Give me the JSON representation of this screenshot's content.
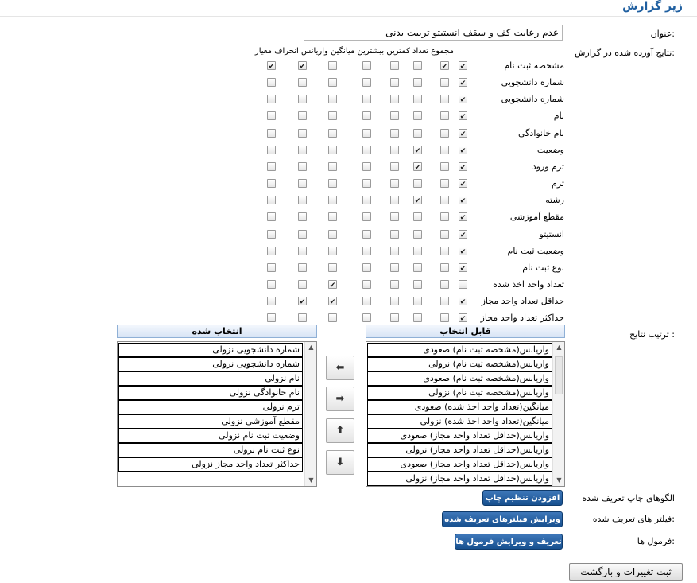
{
  "section_title": "زیر گزارش",
  "title_label": "عنوان:",
  "title_value": "عدم رعایت کف و سقف انستیتو تربیت بدنی",
  "results_label": "نتایج آورده شده در گزارش:",
  "column_headers": "مجموع تعداد کمترین بیشترین میانگین واریانس انحراف معیار",
  "rows": [
    {
      "label": "مشخصه ثبت نام",
      "checks": [
        true,
        true,
        false,
        false,
        false,
        false,
        true,
        true
      ]
    },
    {
      "label": "شماره دانشجویی",
      "checks": [
        true,
        false,
        false,
        false,
        false,
        false,
        false,
        false
      ]
    },
    {
      "label": "شماره دانشجویی",
      "checks": [
        true,
        false,
        false,
        false,
        false,
        false,
        false,
        false
      ]
    },
    {
      "label": "نام",
      "checks": [
        true,
        false,
        false,
        false,
        false,
        false,
        false,
        false
      ]
    },
    {
      "label": "نام خانوادگی",
      "checks": [
        true,
        false,
        false,
        false,
        false,
        false,
        false,
        false
      ]
    },
    {
      "label": "وضعیت",
      "checks": [
        true,
        false,
        true,
        false,
        false,
        false,
        false,
        false
      ]
    },
    {
      "label": "ترم ورود",
      "checks": [
        true,
        false,
        true,
        false,
        false,
        false,
        false,
        false
      ]
    },
    {
      "label": "ترم",
      "checks": [
        true,
        false,
        false,
        false,
        false,
        false,
        false,
        false
      ]
    },
    {
      "label": "رشته",
      "checks": [
        true,
        false,
        true,
        false,
        false,
        false,
        false,
        false
      ]
    },
    {
      "label": "مقطع آموزشی",
      "checks": [
        true,
        false,
        false,
        false,
        false,
        false,
        false,
        false
      ]
    },
    {
      "label": "انستیتو",
      "checks": [
        true,
        false,
        false,
        false,
        false,
        false,
        false,
        false
      ]
    },
    {
      "label": "وضعیت ثبت نام",
      "checks": [
        true,
        false,
        false,
        false,
        false,
        false,
        false,
        false
      ]
    },
    {
      "label": "نوع ثبت نام",
      "checks": [
        true,
        false,
        false,
        false,
        false,
        false,
        false,
        false
      ]
    },
    {
      "label": "تعداد واحد اخذ شده",
      "checks": [
        false,
        false,
        false,
        false,
        false,
        true,
        false,
        false
      ]
    },
    {
      "label": "حداقل تعداد واحد مجاز",
      "checks": [
        true,
        false,
        false,
        false,
        false,
        true,
        true,
        false
      ]
    },
    {
      "label": "حداکثر تعداد واحد مجاز",
      "checks": [
        true,
        false,
        false,
        false,
        false,
        false,
        false,
        false
      ]
    }
  ],
  "sort_label": "ترتیب نتایج :",
  "available_header": "قابل انتخاب",
  "selected_header": "انتخاب شده",
  "available_items": [
    "واریانس(مشخصه ثبت نام) صعودی",
    "واریانس(مشخصه ثبت نام) نزولی",
    "واریانس(مشخصه ثبت نام) صعودی",
    "واریانس(مشخصه ثبت نام) نزولی",
    "میانگین(تعداد واحد اخذ شده) صعودی",
    "میانگین(تعداد واحد اخذ شده) نزولی",
    "واریانس(حداقل تعداد واحد مجاز) صعودی",
    "واریانس(حداقل تعداد واحد مجاز) نزولی",
    "واریانس(حداقل تعداد واحد مجاز) صعودی",
    "واریانس(حداقل تعداد واحد مجاز) نزولی"
  ],
  "selected_items": [
    "شماره دانشجویی نزولی",
    "شماره دانشجویی نزولی",
    "نام نزولی",
    "نام خانوادگی نزولی",
    "ترم نزولی",
    "مقطع آموزشی نزولی",
    "وضعیت ثبت نام نزولی",
    "نوع ثبت نام نزولی",
    "حداکثر تعداد واحد مجاز نزولی"
  ],
  "move_buttons": {
    "left": "⬅",
    "right": "➡",
    "up": "⬆",
    "down": "⬇"
  },
  "print_label": "الگوهای چاپ تعریف شده",
  "print_button": "افزودن تنظیم چاپ",
  "filters_label": "فیلتر های تعریف شده:",
  "filters_button": "ویرایش فیلترهای تعریف شده",
  "formulas_label": "فرمول ها:",
  "formulas_button": "تعریف و ویرایش فرمول ها",
  "submit_button": "ثبت تغییرات و بازگشت",
  "colors": {
    "accent": "#1f5fa0",
    "button_blue": "#17508f"
  }
}
